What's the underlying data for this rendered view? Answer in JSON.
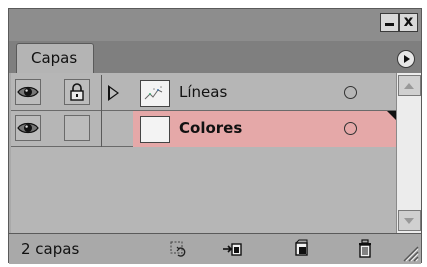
{
  "window": {
    "minimize_icon": "minimize-icon",
    "close_label": "x"
  },
  "panel": {
    "tab_label": "Capas",
    "menu_icon": "panel-menu-icon"
  },
  "layers": [
    {
      "name": "Líneas",
      "visible": true,
      "locked": true,
      "expanded": false,
      "selected": false
    },
    {
      "name": "Colores",
      "visible": true,
      "locked": false,
      "selected": true
    }
  ],
  "footer": {
    "count_label": "2 capas",
    "icons": [
      "link-layers-icon",
      "new-sublayer-icon",
      "new-layer-icon",
      "delete-layer-icon"
    ]
  },
  "colors": {
    "selected_row": "#e5a8a8",
    "panel_bg": "#a9a9a9"
  }
}
